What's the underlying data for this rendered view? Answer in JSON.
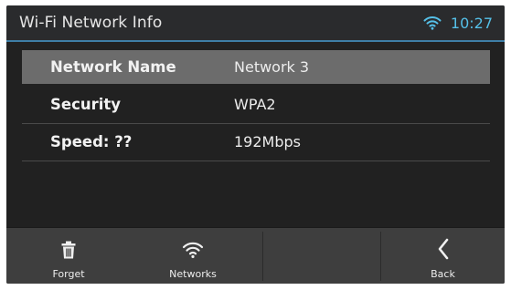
{
  "header": {
    "title": "Wi-Fi Network Info",
    "time": "10:27",
    "wifi_icon": "wifi-icon"
  },
  "info": {
    "rows": [
      {
        "label": "Network Name",
        "value": "Network 3",
        "selected": true
      },
      {
        "label": "Security",
        "value": "WPA2",
        "selected": false
      },
      {
        "label": "Speed: ??",
        "value": "192Mbps",
        "selected": false
      }
    ]
  },
  "footer": {
    "forget": {
      "label": "Forget",
      "icon": "trash-icon"
    },
    "networks": {
      "label": "Networks",
      "icon": "wifi-icon"
    },
    "back": {
      "label": "Back",
      "icon": "chevron-left-icon"
    }
  },
  "colors": {
    "accent": "#55c0e8",
    "header_rule": "#3e7ea6",
    "background": "#212121",
    "footer_bg": "#3e3e3e",
    "selected_row": "#6c6c6c"
  }
}
